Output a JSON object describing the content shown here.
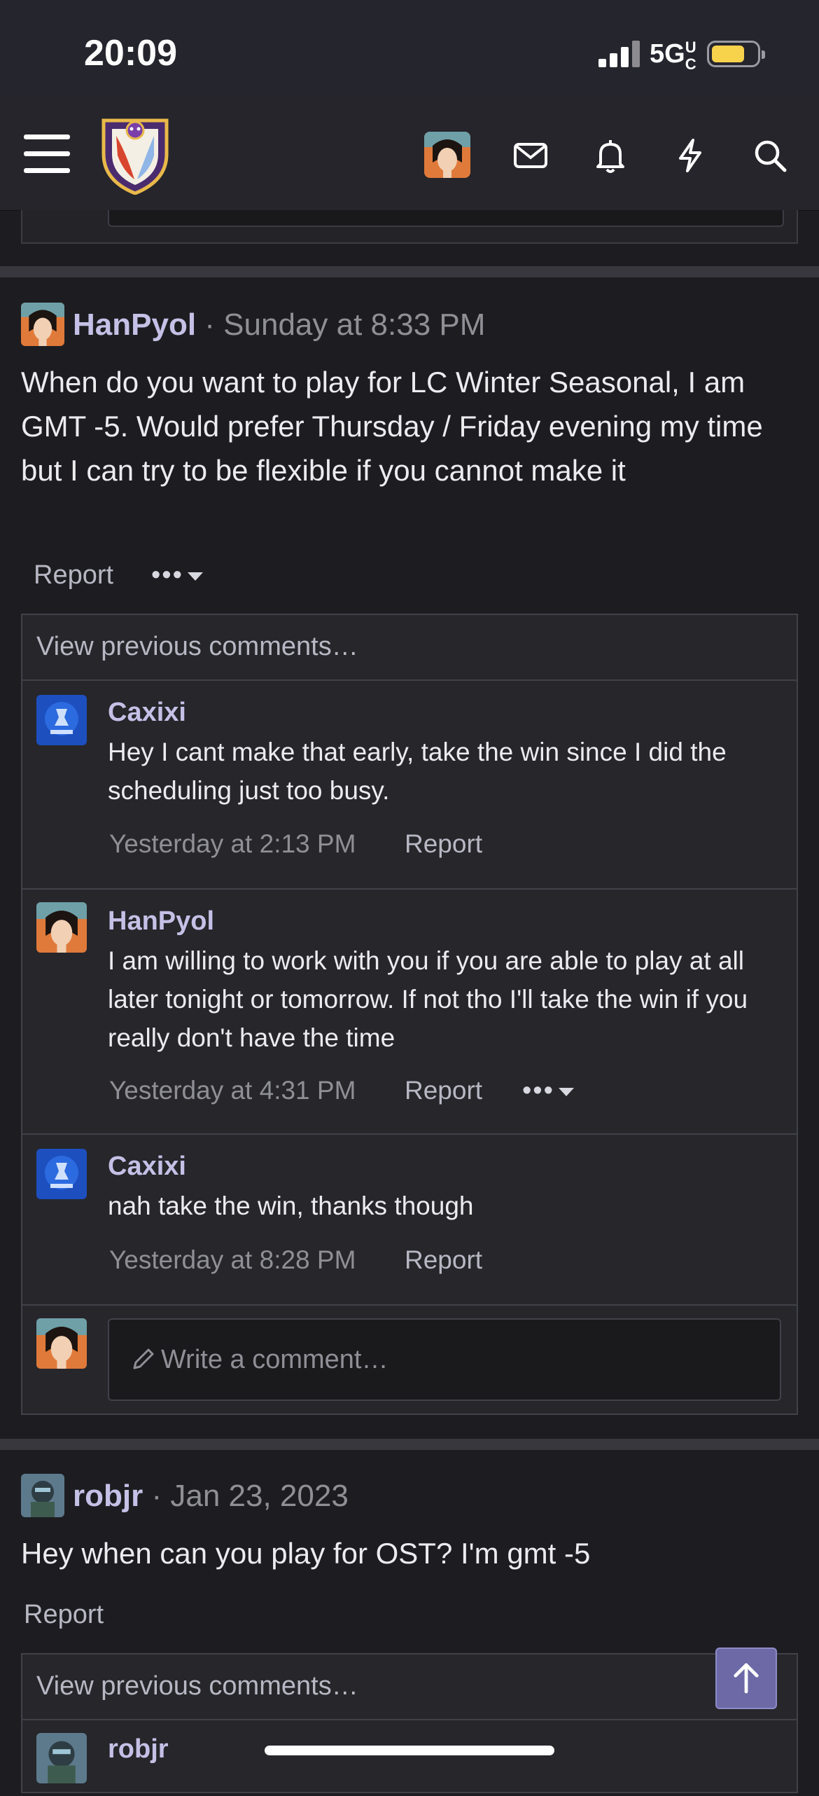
{
  "status_bar": {
    "time": "20:09",
    "network": "5G",
    "network_sup": "UC"
  },
  "nav": {
    "icons": [
      "menu-icon",
      "site-logo",
      "user-avatar",
      "mail-icon",
      "bell-icon",
      "lightning-icon",
      "search-icon"
    ]
  },
  "posts": [
    {
      "author": "HanPyol",
      "timestamp": "Sunday at 8:33 PM",
      "body": "When do you want to play for LC Winter Seasonal, I am GMT -5. Would prefer Thursday / Friday evening my time but I can try to be flexible if you cannot make it",
      "report_label": "Report",
      "more_label": "•••",
      "view_previous": "View previous comments…",
      "comments": [
        {
          "author": "Caxixi",
          "text": "Hey I cant make that early, take the win since I did the scheduling just too busy.",
          "time": "Yesterday at 2:13 PM",
          "report": "Report"
        },
        {
          "author": "HanPyol",
          "text": "I am willing to work with you if you are able to play at all later tonight or tomorrow. If not tho I'll take the win if you really don't have the time",
          "time": "Yesterday at 4:31 PM",
          "report": "Report",
          "more": "•••"
        },
        {
          "author": "Caxixi",
          "text": "nah take the win, thanks though",
          "time": "Yesterday at 8:28 PM",
          "report": "Report"
        }
      ],
      "write_placeholder": "Write a comment…"
    },
    {
      "author": "robjr",
      "timestamp": "Jan 23, 2023",
      "body": "Hey when can you play for OST? I'm gmt -5",
      "report_label": "Report",
      "view_previous": "View previous comments…",
      "comments": [
        {
          "author": "robjr"
        }
      ]
    }
  ],
  "meta_separator": "·",
  "colors": {
    "accent": "#c5c0e6",
    "background": "#1d1d21",
    "scroll_button": "#6c69a6"
  }
}
